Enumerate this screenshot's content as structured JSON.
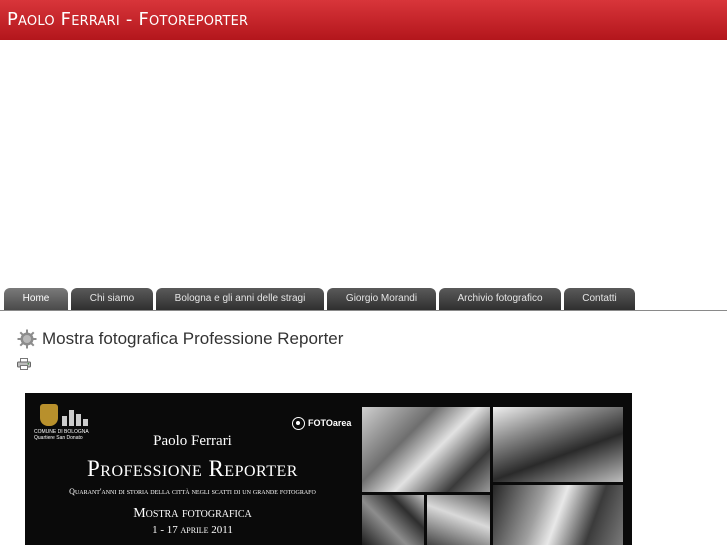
{
  "header": {
    "site_title": "Paolo Ferrari - Fotoreporter"
  },
  "nav": {
    "items": [
      {
        "label": "Home",
        "active": true
      },
      {
        "label": "Chi siamo",
        "active": false
      },
      {
        "label": "Bologna e gli anni delle stragi",
        "active": false
      },
      {
        "label": "Giorgio Morandi",
        "active": false
      },
      {
        "label": "Archivio fotografico",
        "active": false
      },
      {
        "label": "Contatti",
        "active": false
      }
    ]
  },
  "article": {
    "title": "Mostra fotografica Professione Reporter",
    "title_icon": "gear-icon",
    "print_icon": "printer-icon"
  },
  "banner": {
    "comune_line1": "COMUNE DI BOLOGNA",
    "comune_line2": "Quartiere San Donato",
    "partner_logo": "FOTOarea",
    "name": "Paolo Ferrari",
    "title": "Professione Reporter",
    "subtitle": "Quarant'anni di storia della città negli scatti di un grande fotografo",
    "event": "Mostra fotografica",
    "dates": "1 - 17 aprile 2011"
  },
  "colors": {
    "header_red": "#c8262c",
    "tab_dark": "#3a3a3a",
    "banner_bg": "#0a0a0a"
  }
}
